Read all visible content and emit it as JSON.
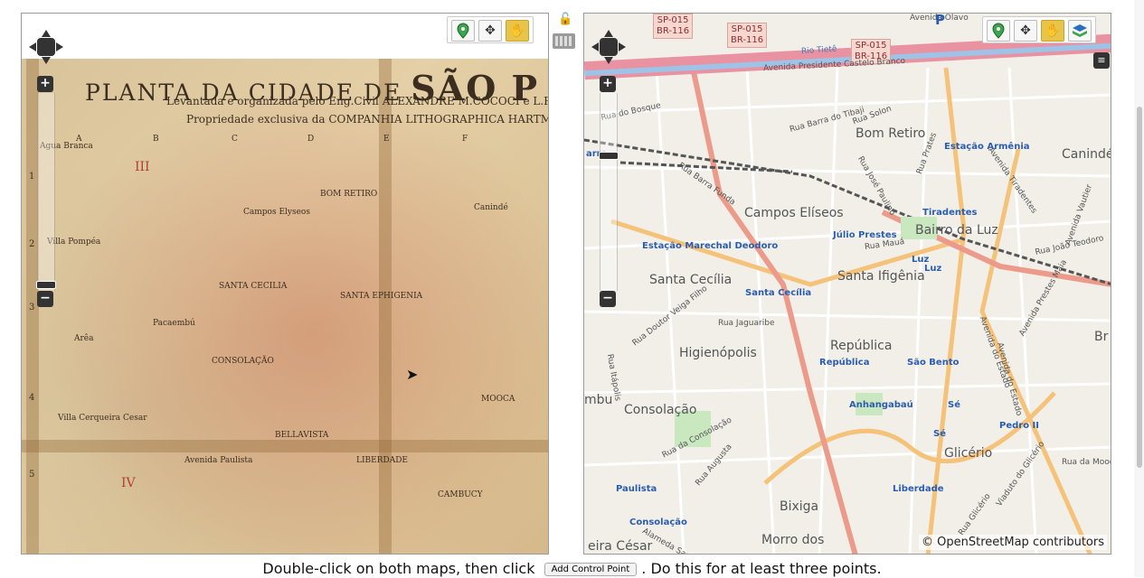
{
  "left_map": {
    "title_prefix": "PLANTA DA CIDADE DE",
    "title_main": "SÃO P",
    "subtitle": "Levantada e organizada pelo Eng.Civil ALEXANDRE M.COCOCI e L.FRUCTUOSO F.C.",
    "subtitle2": "Propriedade exclusiva da COMPANHIA LITHOGRAPHICA HARTMANN-REICH",
    "grid_letters": [
      "A",
      "B",
      "C",
      "D",
      "E",
      "F"
    ],
    "grid_numbers": [
      "1",
      "2",
      "3",
      "4",
      "5"
    ],
    "roman_numerals": [
      "III",
      "IV"
    ],
    "labels": [
      "Agua Branca",
      "Villa Pompéa",
      "BOM RETIRO",
      "Canindé",
      "SANTA CECILIA",
      "SANTA EPHIGENIA",
      "Pacaembú",
      "Arêa",
      "CONSOLAÇÃO",
      "Villa Cerqueira Cesar",
      "BELLAVISTA",
      "Avenida Paulista",
      "Campos Elyseos",
      "LIBERDADE",
      "CAMBUCY",
      "MOOCA"
    ]
  },
  "right_map": {
    "shields": [
      {
        "line1": "SP-015",
        "line2": "BR-116"
      },
      {
        "line1": "SP-015",
        "line2": "BR-116"
      },
      {
        "line1": "SP-015",
        "line2": "BR-116"
      }
    ],
    "districts": [
      "Bom Retiro",
      "Canindé",
      "Campos Elíseos",
      "Bairro da Luz",
      "Santa Cecília",
      "Santa Ifigênia",
      "Higienópolis",
      "República",
      "Consolação",
      "Glicério",
      "Bixiga",
      "Morro dos",
      "eira César",
      "Rio Tietê",
      "mbu"
    ],
    "stations": [
      "Estação Armênia",
      "Tiradentes",
      "Júlio Prestes",
      "Luz",
      "Luz",
      "Estação Marechal Deodoro",
      "Santa Cecília",
      "República",
      "São Bento",
      "Anhangabaú",
      "Sé",
      "Sé",
      "Pedro II",
      "Liberdade",
      "Paulista",
      "Consolação",
      "arra",
      "Br"
    ],
    "streets": [
      "Avenida Olavo",
      "Avenida Presidente Castelo Branco",
      "Rua do Bosque",
      "Rua Barra do Tibaji",
      "Rua Solon",
      "Rua Barra Funda",
      "Rua José Paulino",
      "Rua Mauá",
      "Rua João Teodoro",
      "Rua Doutor Veiga Filho",
      "Rua Jaguaribe",
      "Rua Itápolis",
      "Rua da Consolação",
      "Rua Augusta",
      "Rua da Mooca",
      "Avenida do Estado",
      "Rua Prates",
      "Avenida Tiradentes",
      "Avenida Vautier",
      "Rua Glicério",
      "Viaduto do Glicério",
      "Alameda Santos",
      "Avenida Prestes Maia",
      "Avenida do Estado"
    ],
    "attribution": "© OpenStreetMap contributors",
    "poi_letter": "P"
  },
  "toolbar": {
    "tools": [
      "add-point-icon",
      "move-icon",
      "pan-hand-icon"
    ],
    "active_tool": "pan-hand-icon",
    "extra_tool": "layers-icon"
  },
  "instructions": {
    "before": "Double-click on both maps, then click",
    "button": "Add Control Point",
    "after": ". Do this for at least three points."
  },
  "colors": {
    "active_tool": "#e8c54a",
    "highway": "#e892a2",
    "station_text": "#2a5db0",
    "map_background": "#f2efe9",
    "old_map_paper": "#d9c39a"
  }
}
